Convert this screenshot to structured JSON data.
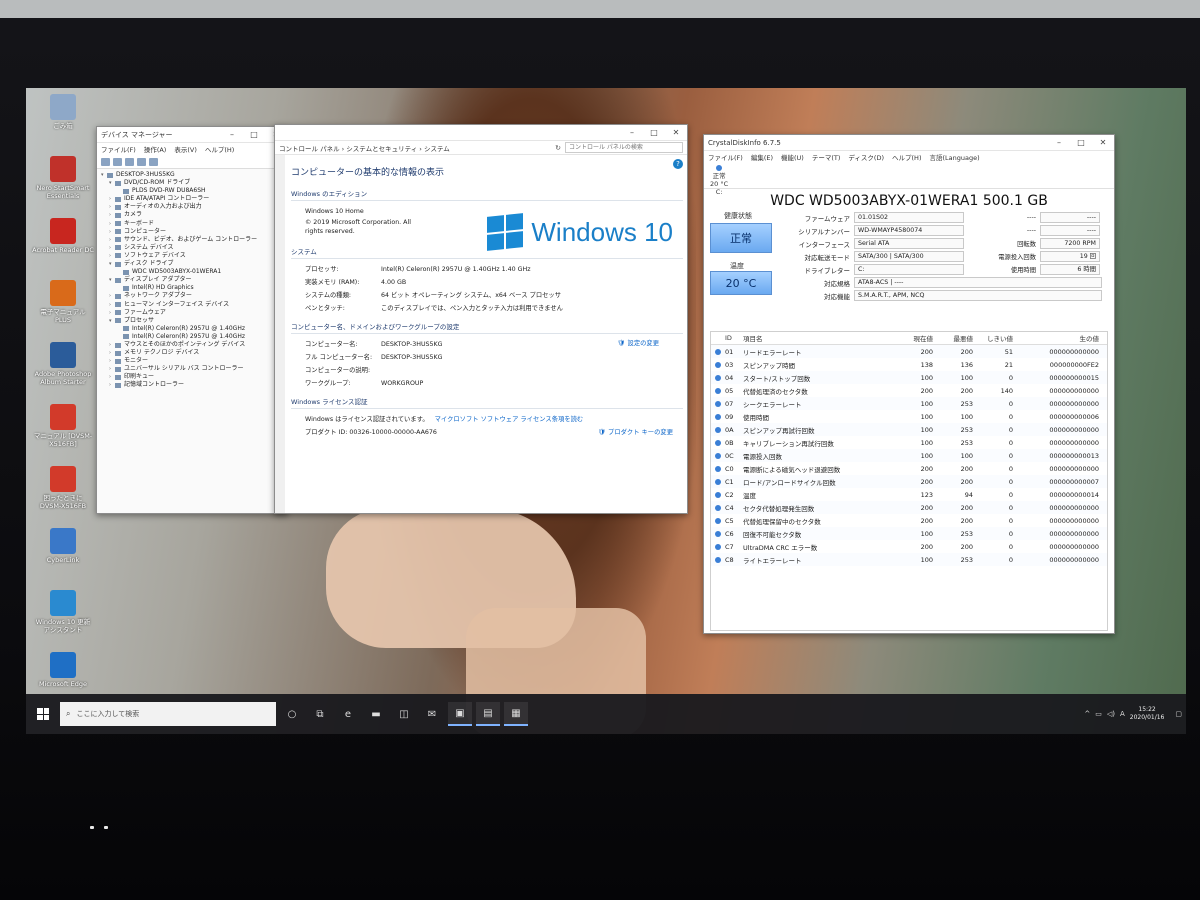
{
  "desktop": {
    "icons": [
      {
        "label": "ごみ箱",
        "color": "#8ea8c8",
        "icon": "recycle-bin-icon"
      },
      {
        "label": "Nero StartSmart Essentials",
        "color": "#c0312a",
        "icon": "nero-icon"
      },
      {
        "label": "Acrobat Reader DC",
        "color": "#c8261f",
        "icon": "acrobat-icon"
      },
      {
        "label": "電子マニュアル PLUS",
        "color": "#d96a1a",
        "icon": "manual-icon"
      },
      {
        "label": "Adobe Photoshop Album Starter",
        "color": "#2b5c9a",
        "icon": "photoshop-album-icon"
      },
      {
        "label": "マニュアル [DVSM-X516FB]",
        "color": "#d23a2a",
        "icon": "pdf-icon"
      },
      {
        "label": "困ったときに DVSM-X516FB",
        "color": "#d23a2a",
        "icon": "pdf-icon"
      },
      {
        "label": "CyberLink",
        "color": "#3a78c8",
        "icon": "cyberlink-icon"
      },
      {
        "label": "Windows 10 更新 アシスタント",
        "color": "#2a8ad0",
        "icon": "windows-update-icon"
      },
      {
        "label": "Microsoft Edge",
        "color": "#1f6fc5",
        "icon": "edge-icon"
      }
    ]
  },
  "device_manager": {
    "title": "デバイス マネージャー",
    "menu": [
      "ファイル(F)",
      "操作(A)",
      "表示(V)",
      "ヘルプ(H)"
    ],
    "tree": [
      {
        "text": "DESKTOP-3HUS5KG",
        "indent": 0,
        "arrow": "▾"
      },
      {
        "text": "DVD/CD-ROM ドライブ",
        "indent": 1,
        "arrow": "▾"
      },
      {
        "text": "PLDS DVD-RW DU8A6SH",
        "indent": 2,
        "arrow": ""
      },
      {
        "text": "IDE ATA/ATAPI コントローラー",
        "indent": 1,
        "arrow": "›"
      },
      {
        "text": "オーディオの入力および出力",
        "indent": 1,
        "arrow": "›"
      },
      {
        "text": "カメラ",
        "indent": 1,
        "arrow": "›"
      },
      {
        "text": "キーボード",
        "indent": 1,
        "arrow": "›"
      },
      {
        "text": "コンピューター",
        "indent": 1,
        "arrow": "›"
      },
      {
        "text": "サウンド、ビデオ、およびゲーム コントローラー",
        "indent": 1,
        "arrow": "›"
      },
      {
        "text": "システム デバイス",
        "indent": 1,
        "arrow": "›"
      },
      {
        "text": "ソフトウェア デバイス",
        "indent": 1,
        "arrow": "›"
      },
      {
        "text": "ディスク ドライブ",
        "indent": 1,
        "arrow": "▾"
      },
      {
        "text": "WDC WD5003ABYX-01WERA1",
        "indent": 2,
        "arrow": ""
      },
      {
        "text": "ディスプレイ アダプター",
        "indent": 1,
        "arrow": "▾"
      },
      {
        "text": "Intel(R) HD Graphics",
        "indent": 2,
        "arrow": ""
      },
      {
        "text": "ネットワーク アダプター",
        "indent": 1,
        "arrow": "›"
      },
      {
        "text": "ヒューマン インターフェイス デバイス",
        "indent": 1,
        "arrow": "›"
      },
      {
        "text": "ファームウェア",
        "indent": 1,
        "arrow": "›"
      },
      {
        "text": "プロセッサ",
        "indent": 1,
        "arrow": "▾"
      },
      {
        "text": "Intel(R) Celeron(R) 2957U @ 1.40GHz",
        "indent": 2,
        "arrow": ""
      },
      {
        "text": "Intel(R) Celeron(R) 2957U @ 1.40GHz",
        "indent": 2,
        "arrow": ""
      },
      {
        "text": "マウスとそのほかのポインティング デバイス",
        "indent": 1,
        "arrow": "›"
      },
      {
        "text": "メモリ テクノロジ デバイス",
        "indent": 1,
        "arrow": "›"
      },
      {
        "text": "モニター",
        "indent": 1,
        "arrow": "›"
      },
      {
        "text": "ユニバーサル シリアル バス コントローラー",
        "indent": 1,
        "arrow": "›"
      },
      {
        "text": "印刷キュー",
        "indent": 1,
        "arrow": "›"
      },
      {
        "text": "記憶域コントローラー",
        "indent": 1,
        "arrow": "›"
      }
    ]
  },
  "system_window": {
    "breadcrumb": "コントロール パネル  ›  システムとセキュリティ  ›  システム",
    "search_placeholder": "コントロール パネルの検索",
    "heading": "コンピューターの基本的な情報の表示",
    "edition_section": "Windows のエディション",
    "edition_name": "Windows 10 Home",
    "copyright": "© 2019 Microsoft Corporation. All rights reserved.",
    "brand": "Windows 10",
    "system_section": "システム",
    "system_rows": [
      {
        "k": "プロセッサ:",
        "v": "Intel(R) Celeron(R) 2957U @ 1.40GHz   1.40 GHz"
      },
      {
        "k": "実装メモリ (RAM):",
        "v": "4.00 GB"
      },
      {
        "k": "システムの種類:",
        "v": "64 ビット オペレーティング システム、x64 ベース プロセッサ"
      },
      {
        "k": "ペンとタッチ:",
        "v": "このディスプレイでは、ペン入力とタッチ入力は利用できません"
      }
    ],
    "computer_section": "コンピューター名、ドメインおよびワークグループの設定",
    "computer_rows": [
      {
        "k": "コンピューター名:",
        "v": "DESKTOP-3HUS5KG"
      },
      {
        "k": "フル コンピューター名:",
        "v": "DESKTOP-3HUS5KG"
      },
      {
        "k": "コンピューターの説明:",
        "v": ""
      },
      {
        "k": "ワークグループ:",
        "v": "WORKGROUP"
      }
    ],
    "change_settings": "設定の変更",
    "license_section": "Windows ライセンス認証",
    "license_text": "Windows はライセンス認証されています。",
    "license_link": "マイクロソフト ソフトウェア ライセンス条項を読む",
    "product_id": "プロダクト ID: 00326-10000-00000-AA676",
    "change_product_key": "プロダクト キーの変更"
  },
  "crystaldiskinfo": {
    "title": "CrystalDiskInfo 6.7.5",
    "menu": [
      "ファイル(F)",
      "編集(E)",
      "機能(U)",
      "テーマ(T)",
      "ディスク(D)",
      "ヘルプ(H)",
      "言語(Language)"
    ],
    "drive_status": "正常",
    "drive_temp": "20 °C",
    "drive_letter": "C:",
    "model": "WDC WD5003ABYX-01WERA1 500.1 GB",
    "health_label": "健康状態",
    "health_value": "正常",
    "temp_label": "温度",
    "temp_value": "20 °C",
    "firmware_label": "ファームウェア",
    "firmware": "01.01S02",
    "serial_label": "シリアルナンバー",
    "serial": "WD-WMAYP4580074",
    "interface_label": "インターフェース",
    "interface": "Serial ATA",
    "transfer_label": "対応転送モード",
    "transfer": "SATA/300 | SATA/300",
    "letter_label": "ドライブレター",
    "letter": "C:",
    "standard_label": "対応規格",
    "standard": "ATA8-ACS | ----",
    "features_label": "対応機能",
    "features": "S.M.A.R.T., APM, NCQ",
    "rpm_label": "回転数",
    "rpm": "7200 RPM",
    "power_count_label": "電源投入回数",
    "power_count": "19 回",
    "hours_label": "使用時間",
    "hours": "6 時間",
    "blank1": "----",
    "blank2": "----",
    "smart_headers": {
      "id": "ID",
      "name": "項目名",
      "current": "現在値",
      "worst": "最悪値",
      "threshold": "しきい値",
      "raw": "生の値"
    },
    "smart": [
      {
        "id": "01",
        "name": "リードエラーレート",
        "cur": "200",
        "wor": "200",
        "thr": "51",
        "raw": "000000000000"
      },
      {
        "id": "03",
        "name": "スピンアップ時間",
        "cur": "138",
        "wor": "136",
        "thr": "21",
        "raw": "000000000FE2"
      },
      {
        "id": "04",
        "name": "スタート/ストップ回数",
        "cur": "100",
        "wor": "100",
        "thr": "0",
        "raw": "000000000015"
      },
      {
        "id": "05",
        "name": "代替処理済のセクタ数",
        "cur": "200",
        "wor": "200",
        "thr": "140",
        "raw": "000000000000"
      },
      {
        "id": "07",
        "name": "シークエラーレート",
        "cur": "100",
        "wor": "253",
        "thr": "0",
        "raw": "000000000000"
      },
      {
        "id": "09",
        "name": "使用時間",
        "cur": "100",
        "wor": "100",
        "thr": "0",
        "raw": "000000000006"
      },
      {
        "id": "0A",
        "name": "スピンアップ再試行回数",
        "cur": "100",
        "wor": "253",
        "thr": "0",
        "raw": "000000000000"
      },
      {
        "id": "0B",
        "name": "キャリブレーション再試行回数",
        "cur": "100",
        "wor": "253",
        "thr": "0",
        "raw": "000000000000"
      },
      {
        "id": "0C",
        "name": "電源投入回数",
        "cur": "100",
        "wor": "100",
        "thr": "0",
        "raw": "000000000013"
      },
      {
        "id": "C0",
        "name": "電源断による磁気ヘッド退避回数",
        "cur": "200",
        "wor": "200",
        "thr": "0",
        "raw": "000000000000"
      },
      {
        "id": "C1",
        "name": "ロード/アンロードサイクル回数",
        "cur": "200",
        "wor": "200",
        "thr": "0",
        "raw": "000000000007"
      },
      {
        "id": "C2",
        "name": "温度",
        "cur": "123",
        "wor": "94",
        "thr": "0",
        "raw": "000000000014"
      },
      {
        "id": "C4",
        "name": "セクタ代替処理発生回数",
        "cur": "200",
        "wor": "200",
        "thr": "0",
        "raw": "000000000000"
      },
      {
        "id": "C5",
        "name": "代替処理保留中のセクタ数",
        "cur": "200",
        "wor": "200",
        "thr": "0",
        "raw": "000000000000"
      },
      {
        "id": "C6",
        "name": "回復不可能セクタ数",
        "cur": "100",
        "wor": "253",
        "thr": "0",
        "raw": "000000000000"
      },
      {
        "id": "C7",
        "name": "UltraDMA CRC エラー数",
        "cur": "200",
        "wor": "200",
        "thr": "0",
        "raw": "000000000000"
      },
      {
        "id": "C8",
        "name": "ライトエラーレート",
        "cur": "100",
        "wor": "253",
        "thr": "0",
        "raw": "000000000000"
      }
    ]
  },
  "taskbar": {
    "search_placeholder": "ここに入力して検索",
    "icons": [
      "cortana-icon",
      "task-view-icon",
      "edge-icon",
      "file-explorer-icon",
      "store-icon",
      "mail-icon",
      "device-manager-icon",
      "system-icon",
      "crystaldiskinfo-icon"
    ],
    "icon_glyphs": [
      "○",
      "⧉",
      "e",
      "▬",
      "◫",
      "✉",
      "▣",
      "▤",
      "▦"
    ],
    "ime": "A",
    "time": "15:22",
    "date": "2020/01/16"
  },
  "colors": {
    "accent": "#1a8ad4",
    "health_blue": "#6aa9f0",
    "status_dot": "#3a7fd6"
  }
}
